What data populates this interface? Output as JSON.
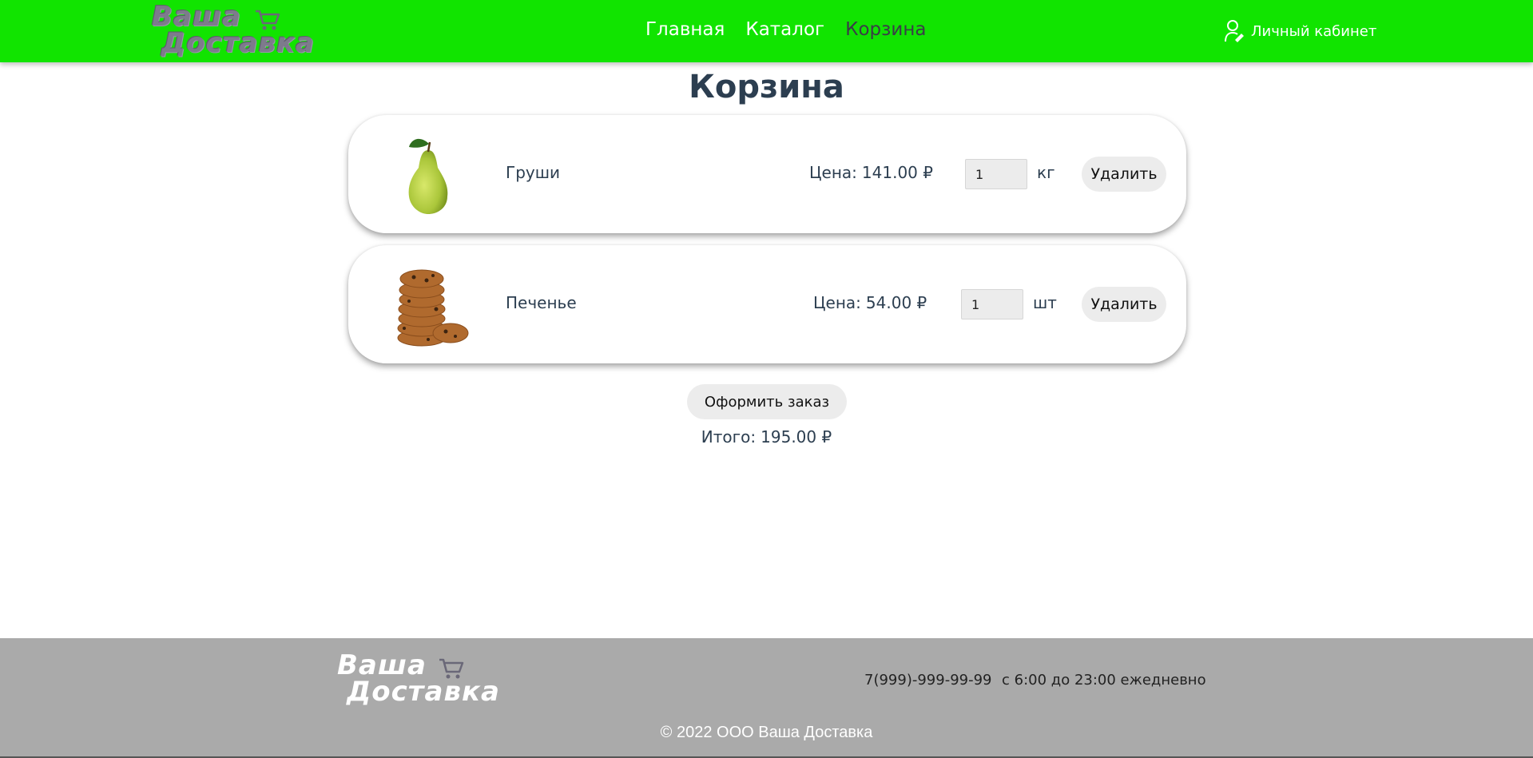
{
  "header": {
    "logo": {
      "line1": "Ваша",
      "line2": "Доставка",
      "icon": "cart-icon"
    },
    "nav": [
      {
        "label": "Главная",
        "active": false
      },
      {
        "label": "Каталог",
        "active": false
      },
      {
        "label": "Корзина",
        "active": true
      }
    ],
    "account": {
      "label": "Личный кабинет",
      "icon": "user-icon"
    }
  },
  "page_title": "Корзина",
  "cart": {
    "items": [
      {
        "name": "Груши",
        "price_label": "Цена:",
        "price": "141.00 ₽",
        "quantity": "1",
        "unit": "кг",
        "delete_label": "Удалить",
        "image": "pear-image"
      },
      {
        "name": "Печенье",
        "price_label": "Цена:",
        "price": "54.00 ₽",
        "quantity": "1",
        "unit": "шт",
        "delete_label": "Удалить",
        "image": "cookies-image"
      }
    ],
    "order_label": "Оформить заказ",
    "total_label": "Итого:",
    "total": "195.00 ₽"
  },
  "footer": {
    "logo": {
      "line1": "Ваша",
      "line2": "Доставка",
      "icon": "cart-icon"
    },
    "phone": "7(999)-999-99-99",
    "hours": "с 6:00 до 23:00 ежедневно",
    "copyright": "© 2022 ООО Ваша Доставка"
  },
  "colors": {
    "header_bg": "#11e400",
    "footer_bg": "#aaaaaa",
    "text": "#2c3e50",
    "button_bg": "#ececec",
    "nav_active": "#3a3d48"
  }
}
